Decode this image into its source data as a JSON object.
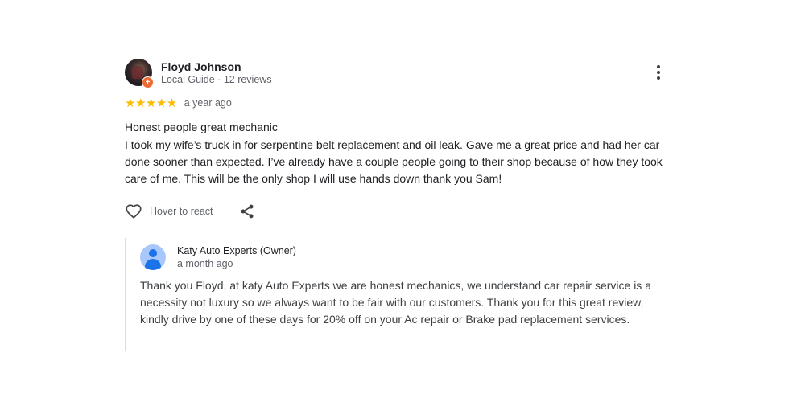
{
  "review": {
    "reviewer_name": "Floyd Johnson",
    "reviewer_meta": "Local Guide · 12 reviews",
    "badge_symbol": "+",
    "rating": 5,
    "stars": "★★★★★",
    "time_ago": "a year ago",
    "title": "Honest people great mechanic",
    "body": "I took my wife’s truck in for serpentine belt replacement and oil leak. Gave me a great price and had her car done sooner than expected. I’ve already have a couple people going to their shop because of how they took care of me. This will be the only shop I will use hands down thank you Sam!",
    "react_label": "Hover to react",
    "icons": {
      "more": "more-vert-icon",
      "like": "heart-icon",
      "share": "share-icon"
    }
  },
  "owner_response": {
    "name": "Katy Auto Experts (Owner)",
    "time_ago": "a month ago",
    "text": "Thank you Floyd, at katy Auto Experts we are honest mechanics, we understand car repair service is a necessity not luxury so we always want to be fair with our customers. Thank you for this great review, kindly drive by one of these days for 20% off on your Ac repair or Brake pad replacement services."
  },
  "colors": {
    "star": "#fbbc04",
    "local_guide_badge": "#ee6a35",
    "owner_avatar_bg": "#a8c7fa",
    "owner_avatar_fg": "#1a73e8",
    "reply_border": "#dadce0"
  }
}
